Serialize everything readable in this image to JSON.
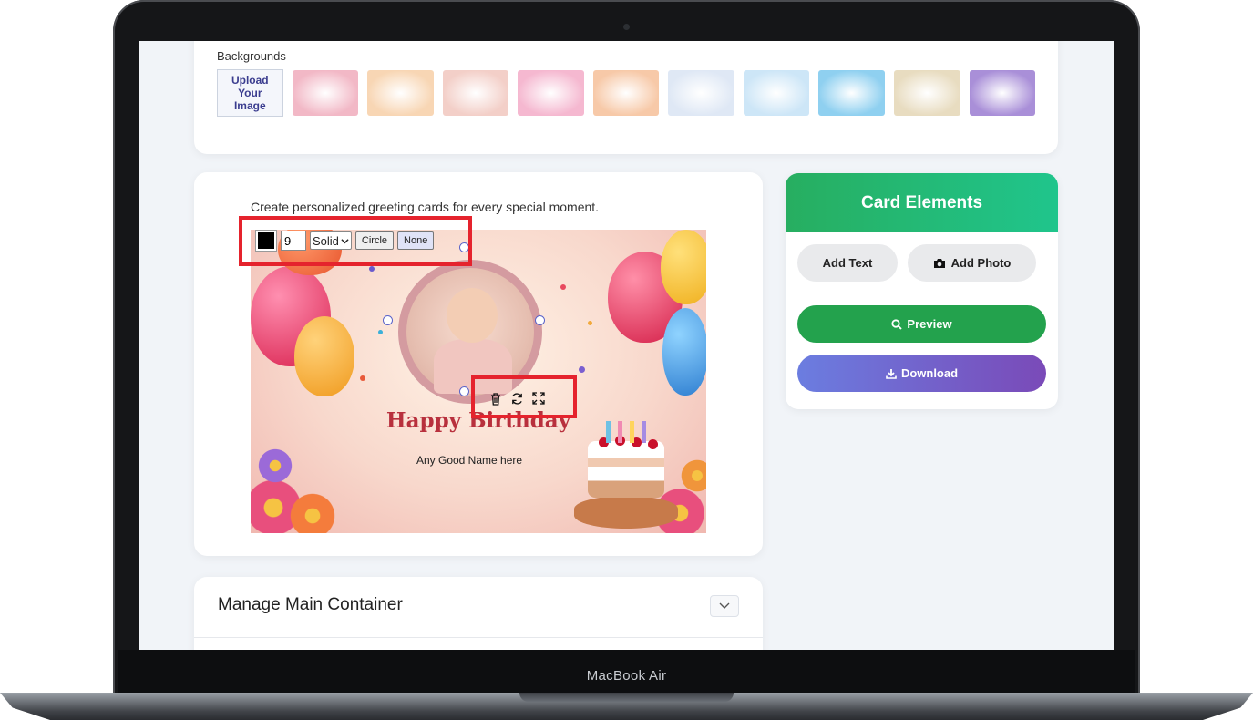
{
  "device": {
    "model_label": "MacBook Air"
  },
  "backgrounds": {
    "title": "Backgrounds",
    "upload_label": "Upload\nYour\nImage",
    "thumbnail_colors": [
      "#f2b8c6",
      "#f8d6b4",
      "#f3cfc8",
      "#f5b8d0",
      "#f7c9a8",
      "#dfe8f5",
      "#cde6f7",
      "#8fd0f0",
      "#e8dcc0",
      "#a98fd8"
    ]
  },
  "editor": {
    "tagline": "Create personalized greeting cards for every special moment.",
    "toolbar": {
      "border_color": "#000000",
      "border_width": "9",
      "border_style": "Solid",
      "shape_button": "Circle",
      "none_button": "None"
    },
    "card": {
      "heading": "Happy Birthday",
      "name_text": "Any Good Name here"
    },
    "highlight_color": "#e5232d"
  },
  "manage": {
    "title": "Manage Main Container"
  },
  "elements": {
    "title": "Card Elements",
    "add_text": "Add Text",
    "add_photo": "Add Photo",
    "preview": "Preview",
    "download": "Download"
  }
}
